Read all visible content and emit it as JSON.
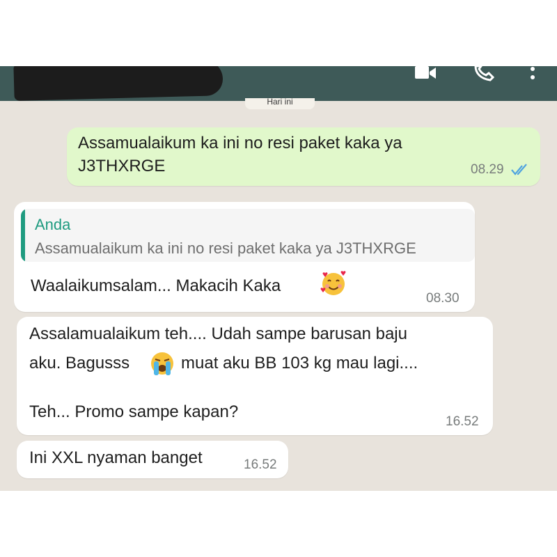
{
  "app": {
    "colors": {
      "header": "#3e5a58",
      "wallpaper": "#e8e3dc",
      "outgoing_bubble": "#e1f8cb",
      "incoming_bubble": "#ffffff",
      "quote_accent": "#1f9b80",
      "read_ticks": "#4fa3e0"
    },
    "header_icons": [
      "video-call-icon",
      "voice-call-icon",
      "more-options-icon"
    ]
  },
  "chat": {
    "date_divider": "Hari ini",
    "messages": [
      {
        "direction": "outgoing",
        "text": "Assamualaikum ka ini no resi paket kaka ya\nJ3THXRGE",
        "time": "08.29",
        "status_icon": "double-check-read-icon"
      },
      {
        "direction": "incoming",
        "reply_to": {
          "author": "Anda",
          "text": "Assamualaikum ka ini no resi paket kaka ya J3THXRGE"
        },
        "text": "Waalaikumsalam... Makacih Kaka",
        "emoji": "smiling-face-with-hearts-emoji",
        "time": "08.30"
      },
      {
        "direction": "incoming",
        "line1": "Assalamualaikum teh.... Udah sampe barusan baju",
        "line2a": "aku. Bagusss",
        "emoji": "loudly-crying-face-emoji",
        "line2b": "muat aku BB 103 kg mau lagi....",
        "line3": "Teh... Promo sampe kapan?",
        "time": "16.52"
      },
      {
        "direction": "incoming",
        "text": "Ini XXL nyaman banget",
        "time": "16.52"
      }
    ]
  }
}
